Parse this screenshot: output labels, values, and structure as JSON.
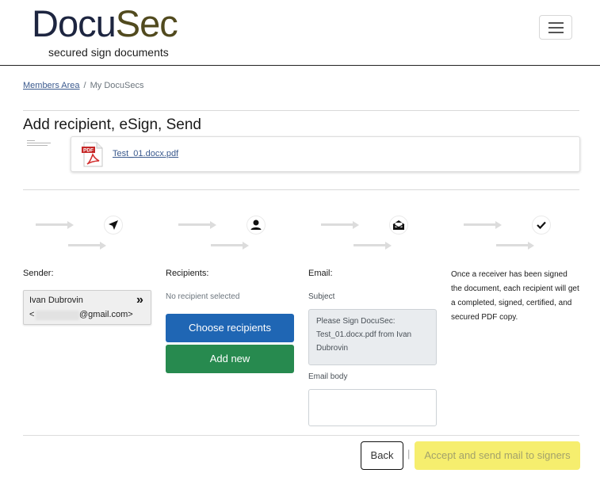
{
  "header": {
    "logo_part1": "Docu",
    "logo_part2": "Sec",
    "tagline": "secured sign documents",
    "menu_icon": "hamburger-menu-icon"
  },
  "breadcrumb": {
    "link": "Members Area",
    "separator": "/",
    "current": "My DocuSecs"
  },
  "page": {
    "title": "Add recipient, eSign, Send",
    "file_name": "Test_01.docx.pdf",
    "file_icon": "pdf-file-icon"
  },
  "steps": [
    {
      "icon": "paper-plane-icon"
    },
    {
      "icon": "user-icon"
    },
    {
      "icon": "mail-open-icon"
    },
    {
      "icon": "checkmark-icon"
    }
  ],
  "sender": {
    "label": "Sender:",
    "name": "Ivan Dubrovin",
    "email_open": "<",
    "email_domain": "@gmail.com>",
    "expand_icon": "double-chevron-right-icon"
  },
  "recipients": {
    "label": "Recipients:",
    "empty_text": "No recipient selected",
    "choose_button": "Choose recipients",
    "add_button": "Add new"
  },
  "email": {
    "label": "Email:",
    "subject_label": "Subject",
    "subject_value": "Please Sign DocuSec: Test_01.docx.pdf from Ivan Dubrovin",
    "body_label": "Email body",
    "body_value": ""
  },
  "info": {
    "text": "Once a receiver has been signed the document, each recipient will get a completed, signed, certified, and secured PDF copy."
  },
  "footer": {
    "back_button": "Back",
    "divider": "|",
    "accept_button": "Accept and send mail to signers"
  },
  "colors": {
    "blue_button": "#1f66b4",
    "green_button": "#278a4f",
    "accept_button": "#f6ee6e",
    "pdf_red": "#d32f2f"
  }
}
